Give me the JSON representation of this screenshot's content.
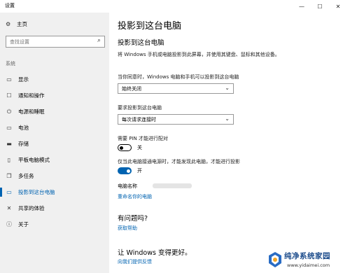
{
  "window": {
    "title": "设置",
    "minimize_glyph": "—",
    "maximize_glyph": "☐",
    "close_glyph": "✕"
  },
  "sidebar": {
    "home_label": "主页",
    "search_placeholder": "查找设置",
    "section_label": "系统",
    "items": [
      {
        "label": "显示",
        "icon": "display-icon",
        "glyph": "▭"
      },
      {
        "label": "通知和操作",
        "icon": "notification-icon",
        "glyph": "☐"
      },
      {
        "label": "电源和睡眠",
        "icon": "power-icon",
        "glyph": "⏻"
      },
      {
        "label": "电池",
        "icon": "battery-icon",
        "glyph": "▭"
      },
      {
        "label": "存储",
        "icon": "storage-icon",
        "glyph": "▬"
      },
      {
        "label": "平板电脑模式",
        "icon": "tablet-icon",
        "glyph": "▯"
      },
      {
        "label": "多任务",
        "icon": "multitask-icon",
        "glyph": "❐"
      },
      {
        "label": "投影到这台电脑",
        "icon": "project-icon",
        "glyph": "▭"
      },
      {
        "label": "共享的体验",
        "icon": "share-icon",
        "glyph": "✕"
      },
      {
        "label": "关于",
        "icon": "info-icon",
        "glyph": "ⓘ"
      }
    ],
    "active_index": 7
  },
  "main": {
    "title": "投影到这台电脑",
    "subtitle": "投影到这台电脑",
    "description": "将 Windows 手机或电脑投影到此屏幕，并使用其键盘、鼠标和其他设备。",
    "setting1": {
      "label": "当你同意时，Windows 电脑和手机可以投影到这台电脑",
      "value": "始终关闭"
    },
    "setting2": {
      "label": "要求投影到这台电脑",
      "value": "每次请求连接时"
    },
    "pin": {
      "label": "需要 PIN 才能进行配对",
      "state_text": "关",
      "on": false
    },
    "power": {
      "label": "仅当此电脑接通电源时，才能发现此电脑，才能进行投影",
      "state_text": "开",
      "on": true
    },
    "pc_name_label": "电脑名称",
    "rename_link": "重命名你的电脑",
    "help_heading": "有问题吗?",
    "help_link": "获取帮助",
    "improve_heading": "让 Windows 变得更好。",
    "feedback_link": "向我们提供反馈"
  },
  "watermark": {
    "title": "纯净系统家园",
    "url": "www.yidaimei.com"
  },
  "colors": {
    "accent": "#0063b1",
    "sidebar_bg": "#f0f0f0"
  }
}
